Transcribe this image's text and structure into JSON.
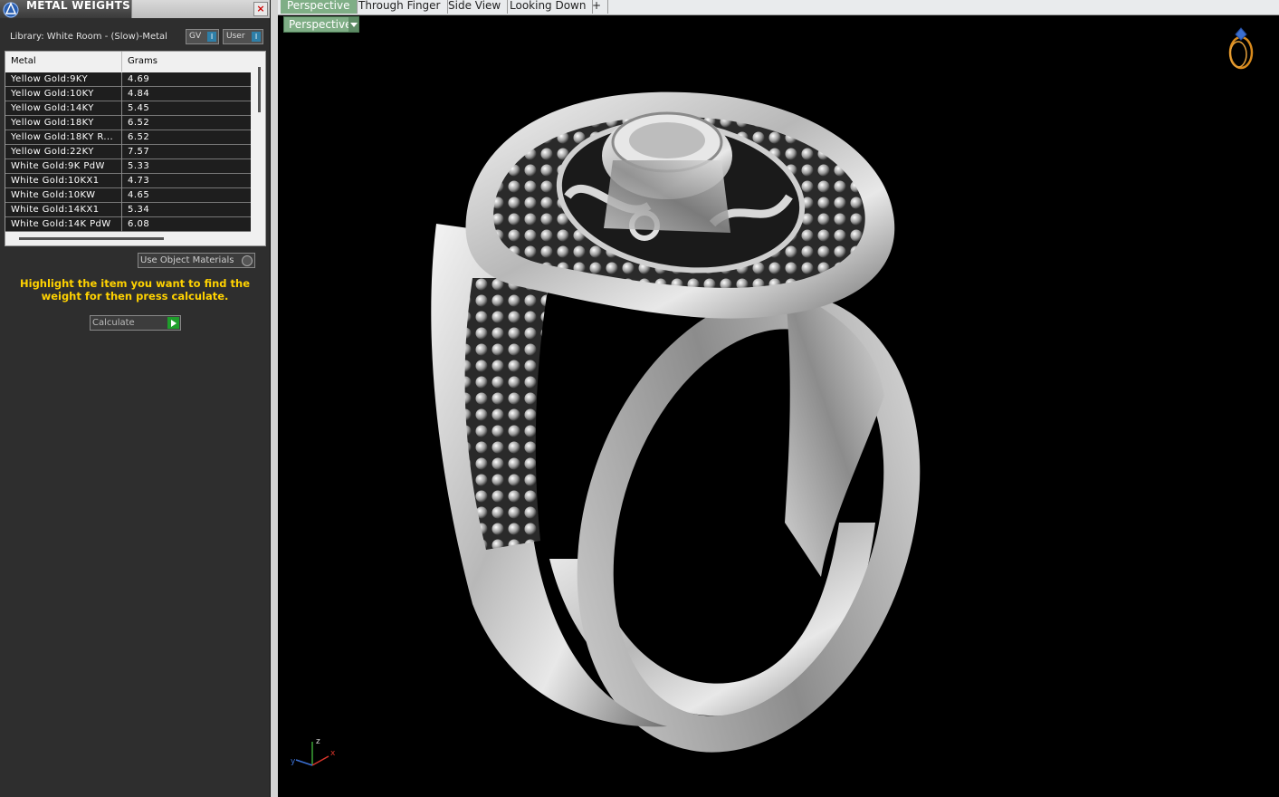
{
  "panel": {
    "title": "METAL WEIGHTS",
    "close": "×",
    "library": "Library: White Room - (Slow)-Metal",
    "toggles": {
      "gv": "GV",
      "user": "User",
      "box": "I"
    },
    "table": {
      "headers": {
        "metal": "Metal",
        "grams": "Grams"
      },
      "rows": [
        {
          "metal": "Yellow Gold:9KY",
          "grams": "4.69"
        },
        {
          "metal": "Yellow Gold:10KY",
          "grams": "4.84"
        },
        {
          "metal": "Yellow Gold:14KY",
          "grams": "5.45"
        },
        {
          "metal": "Yellow Gold:18KY",
          "grams": "6.52"
        },
        {
          "metal": "Yellow Gold:18KY R...",
          "grams": "6.52"
        },
        {
          "metal": "Yellow Gold:22KY",
          "grams": "7.57"
        },
        {
          "metal": "White Gold:9K PdW",
          "grams": "5.33"
        },
        {
          "metal": "White Gold:10KX1",
          "grams": "4.73"
        },
        {
          "metal": "White Gold:10KW",
          "grams": "4.65"
        },
        {
          "metal": "White Gold:14KX1",
          "grams": "5.34"
        },
        {
          "metal": "White Gold:14K PdW",
          "grams": "6.08"
        }
      ]
    },
    "use_object_materials": "Use Object Materials",
    "instruction": "Highlight the item you want to find the weight for then press calculate.",
    "calculate": "Calculate"
  },
  "viewport": {
    "tabs": [
      "Perspective",
      "Through Finger",
      "Side View",
      "Looking Down",
      "+"
    ],
    "active_tab": "Perspective",
    "view_dropdown": "Perspective",
    "axes": {
      "x": "x",
      "y": "y",
      "z": "z"
    }
  },
  "colors": {
    "accent_green": "#7fae86",
    "instruction_yellow": "#ffd200",
    "go_green": "#1f9e2c"
  }
}
